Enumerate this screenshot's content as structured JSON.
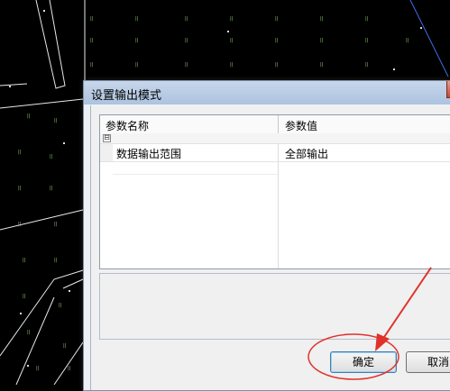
{
  "dialog": {
    "title": "设置输出模式",
    "columns": [
      "参数名称",
      "参数值"
    ],
    "group_toggle": "⊟",
    "rows": [
      {
        "name": "数据输出范围",
        "value": "全部输出"
      }
    ],
    "ok_label": "确定",
    "cancel_label": "取消"
  },
  "colors": {
    "background": "#000000",
    "linework": "#ffffff",
    "annotation_arrow": "#e0312b"
  }
}
